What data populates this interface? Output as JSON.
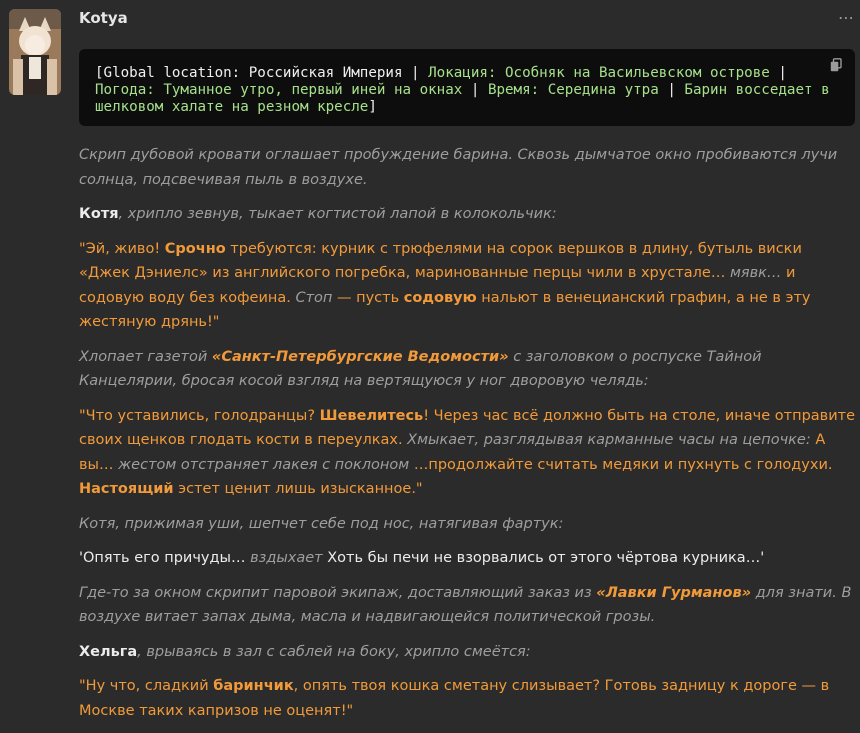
{
  "message": {
    "username": "Kotya",
    "code_block": {
      "seg1": "[Global location: Российская Империя |",
      "seg2": "Локация: Особняк на Васильевском острове",
      "seg3": "|",
      "seg4": "Погода: Туманное утро, первый иней на окнах",
      "seg5": "|",
      "seg6": "Время: Середина утра",
      "seg7": "|",
      "seg8": "Барин восседает в шелковом халате на резном кресле",
      "seg9": "]"
    },
    "paragraphs": {
      "p1": "Скрип дубовой кровати оглашает пробуждение барина. Сквозь дымчатое окно пробиваются лучи солнца, подсвечивая пыль в воздухе.",
      "p2_name": "Котя",
      "p2_rest": ", хрипло зевнув, тыкает когтистой лапой в колокольчик:",
      "p3_a": "\"Эй, живо! ",
      "p3_b": "Срочно",
      "p3_c": " требуются: курник с трюфелями на сорок вершков в длину, бутыль виски «Джек Дэниелс» из английского погребка, маринованные перцы чили в хрустале… ",
      "p3_d": "мявк…",
      "p3_e": " и содовую воду без кофеина. ",
      "p3_f": "Стоп",
      "p3_g": " — пусть ",
      "p3_h": "содовую",
      "p3_i": " нальют в венецианский графин, а не в эту жестяную дрянь!\"",
      "p4_a": "Хлопает газетой ",
      "p4_b": "«Санкт-Петербургские Ведомости»",
      "p4_c": " с заголовком о роспуске Тайной Канцелярии, бросая косой взгляд на вертящуюся у ног дворовую челядь:",
      "p5_a": "\"Что уставились, голодранцы? ",
      "p5_b": "Шевелитесь",
      "p5_c": "! Через час всё должно быть на столе, иначе отправите своих щенков глодать кости в переулках. ",
      "p5_d": "Хмыкает, разглядывая карманные часы на цепочке:",
      "p5_e": " А вы… ",
      "p5_f": "жестом отстраняет лакея с поклоном",
      "p5_g": " …продолжайте считать медяки и пухнуть с голодухи. ",
      "p5_h": "Настоящий",
      "p5_i": " эстет ценит лишь изысканное.\"",
      "p6": "Котя, прижимая уши, шепчет себе под нос, натягивая фартук:",
      "p7_a": "'Опять его причуды… ",
      "p7_b": "вздыхает",
      "p7_c": " Хоть бы печи не взорвались от этого чёртова курника…'",
      "p8_a": "Где-то за окном скрипит паровой экипаж, доставляющий заказ из ",
      "p8_b": "«Лавки Гурманов»",
      "p8_c": " для знати. В воздухе витает запах дыма, масла и надвигающейся политической грозы.",
      "p9_name": "Хельга",
      "p9_rest": ", врываясь в зал с саблей на боку, хрипло смеётся:",
      "p10_a": "\"Ну что, сладкий ",
      "p10_b": "баринчик",
      "p10_c": ", опять твоя кошка сметану слизывает? Готовь задницу к дороге — в Москве таких капризов не оценят!\""
    }
  },
  "icons": {
    "more": "more-horizontal-icon",
    "copy": "copy-icon"
  },
  "colors": {
    "accent_orange": "#f29a3a",
    "code_green": "#a6e08a",
    "background": "#2b2b2b"
  }
}
